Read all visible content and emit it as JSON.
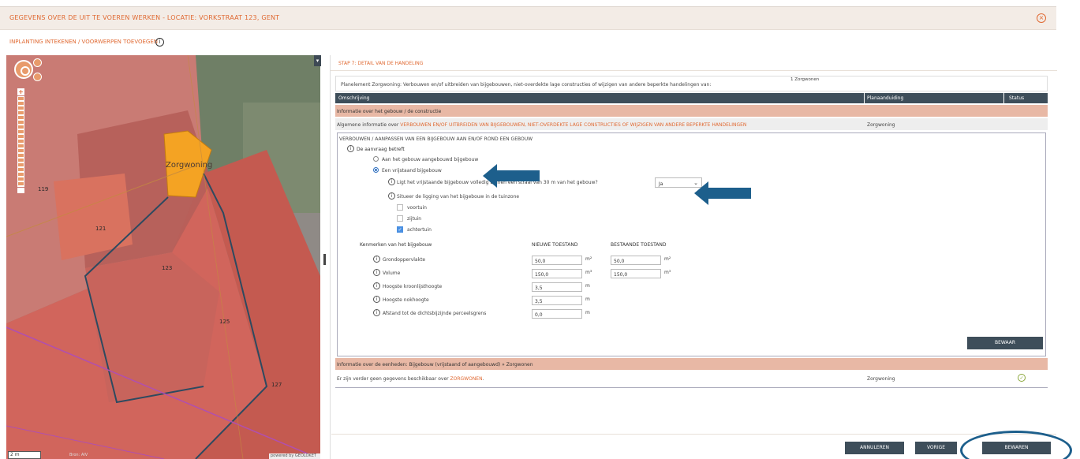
{
  "window": {
    "title": "GEGEVENS OVER DE UIT TE VOEREN WERKEN - LOCATIE: VORKSTRAAT 123, GENT",
    "subtitle": "INPLANTING INTEKENEN / VOORWERPEN TOEVOEGEN"
  },
  "map": {
    "parcel_labels": [
      "119",
      "121",
      "123",
      "125",
      "127"
    ],
    "feature_label": "Zorgwoning",
    "scale_label": "2 m",
    "copyright": "Bron: AIV",
    "powered_by": "powered by GEOLOKET"
  },
  "panel": {
    "step_title": "STAP 7: DETAIL VAN DE HANDELING",
    "planelement_text": "Planelement Zorgwoning: Verbouwen en/of uitbreiden van bijgebouwen, niet-overdekte lage constructies of wijzigen van andere beperkte handelingen van:",
    "planelement_sup": "1 Zorgwonen",
    "table_headers": [
      "Omschrijving",
      "Planaanduiding",
      "Status"
    ],
    "row_building": "Informatie over het gebouw / de constructie",
    "general_info_prefix": "Algemene informatie over ",
    "general_info_link": "VERBOUWEN EN/OF UITBREIDEN VAN BIJGEBOUWEN, NIET-OVERDEKTE LAGE CONSTRUCTIES OF WIJZIGEN VAN ANDERE BEPERKTE HANDELINGEN",
    "general_info_plan": "Zorgwoning",
    "detail_heading": "VERBOUWEN / AANPASSEN VAN EEN BIJGEBOUW AAN EN/OF ROND EEN GEBOUW",
    "question_label": "De aanvraag betreft",
    "option_attached": "Aan het gebouw aangebouwd bijgebouw",
    "option_detached": "Een vrijstaand bijgebouw",
    "q_within_30m": "Ligt het vrijstaande bijgebouw volledig binnen een straal van 30 m van het gebouw?",
    "q_within_30m_value": "Ja",
    "q_situate": "Situeer de ligging van het bijgebouw in de tuinzone",
    "garden_options": [
      {
        "label": "voortuin",
        "checked": false
      },
      {
        "label": "zijtuin",
        "checked": false
      },
      {
        "label": "achtertuin",
        "checked": true
      }
    ],
    "characteristics_label": "Kenmerken van het bijgebouw",
    "col_new": "NIEUWE TOESTAND",
    "col_existing": "BESTAANDE TOESTAND",
    "characteristics": [
      {
        "label": "Grondoppervlakte",
        "new": "50,0",
        "new_unit": "m²",
        "existing": "50,0",
        "existing_unit": "m²"
      },
      {
        "label": "Volume",
        "new": "150,0",
        "new_unit": "m³",
        "existing": "150,0",
        "existing_unit": "m³"
      },
      {
        "label": "Hoogste kroonlijsthoogte",
        "new": "3,5",
        "new_unit": "m",
        "existing": "",
        "existing_unit": ""
      },
      {
        "label": "Hoogste nokhoogte",
        "new": "3,5",
        "new_unit": "m",
        "existing": "",
        "existing_unit": ""
      },
      {
        "label": "Afstand tot de dichtsbijzijnde perceelsgrens",
        "new": "0,0",
        "new_unit": "m",
        "existing": "",
        "existing_unit": ""
      }
    ],
    "save_small": "BEWAAR",
    "row_units": "Informatie over de eenheden: Bijgebouw (vrijstaand of aangebouwd) » Zorgwonen",
    "no_data_prefix": "Er zijn verder geen gegevens beschikbaar over ",
    "no_data_link": "ZORGWONEN",
    "no_data_suffix": ".",
    "no_data_plan": "Zorgwoning"
  },
  "footer": {
    "cancel": "ANNULEREN",
    "previous": "VORIGE",
    "save": "BEWAREN"
  },
  "colors": {
    "accent": "#e06a33",
    "header_dark": "#3e4e5a",
    "row_orange": "#e8b8a5",
    "annotation_blue": "#1d5f8c",
    "status_ok": "#8aa73b"
  }
}
